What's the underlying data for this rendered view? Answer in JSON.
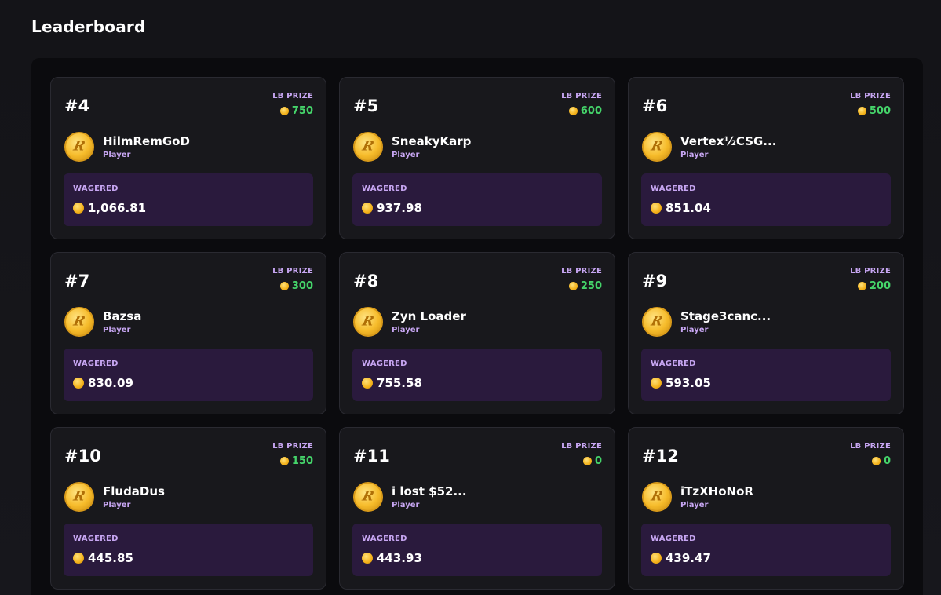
{
  "header": {
    "title": "Leaderboard"
  },
  "labels": {
    "lb_prize": "LB PRIZE",
    "wagered": "WAGERED",
    "player_role": "Player"
  },
  "colors": {
    "prize_value": "#45d46a",
    "accent_label": "#c7a6f2",
    "wager_panel": "#2a1a3d",
    "coin": "#f4b21a"
  },
  "icons": {
    "coin": "coin-icon",
    "avatar": "r-coin-avatar-icon"
  },
  "entries": [
    {
      "rank": "#4",
      "name": "HilmRemGoD",
      "prize": "750",
      "wagered": "1,066.81"
    },
    {
      "rank": "#5",
      "name": "SneakyKarp",
      "prize": "600",
      "wagered": "937.98"
    },
    {
      "rank": "#6",
      "name": "Vertex½CSG...",
      "prize": "500",
      "wagered": "851.04"
    },
    {
      "rank": "#7",
      "name": "Bazsa",
      "prize": "300",
      "wagered": "830.09"
    },
    {
      "rank": "#8",
      "name": "Zyn Loader",
      "prize": "250",
      "wagered": "755.58"
    },
    {
      "rank": "#9",
      "name": "Stage3canc...",
      "prize": "200",
      "wagered": "593.05"
    },
    {
      "rank": "#10",
      "name": "FludaDus",
      "prize": "150",
      "wagered": "445.85"
    },
    {
      "rank": "#11",
      "name": "i lost $52...",
      "prize": "0",
      "wagered": "443.93"
    },
    {
      "rank": "#12",
      "name": "iTzXHoNoR",
      "prize": "0",
      "wagered": "439.47"
    }
  ]
}
